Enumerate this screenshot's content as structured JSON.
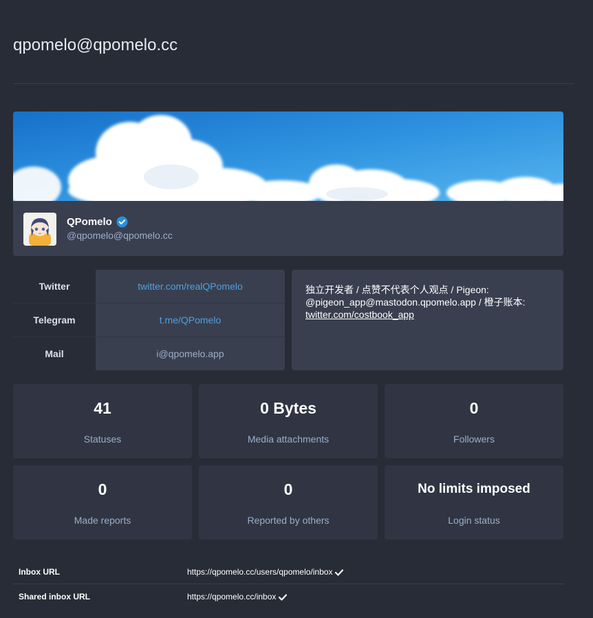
{
  "page": {
    "title": "qpomelo@qpomelo.cc"
  },
  "account": {
    "display_name": "QPomelo",
    "username": "@qpomelo@qpomelo.cc",
    "avatar_icon": "anime-avatar",
    "verified_icon": "verified-badge-icon",
    "accent_color": "#2b90d9"
  },
  "fields": [
    {
      "name": "Twitter",
      "value": "twitter.com/realQPomelo",
      "is_link": true
    },
    {
      "name": "Telegram",
      "value": "t.me/QPomelo",
      "is_link": true
    },
    {
      "name": "Mail",
      "value": "i@qpomelo.app",
      "is_link": false
    }
  ],
  "bio": {
    "line1": "独立开发者 / 点赞不代表个人观点 / Pigeon:",
    "line2": "@pigeon_app@mastodon.qpomelo.app / 橙子账本:",
    "link": "twitter.com/costbook_app"
  },
  "stats": [
    {
      "value": "41",
      "label": "Statuses"
    },
    {
      "value": "0 Bytes",
      "label": "Media attachments"
    },
    {
      "value": "0",
      "label": "Followers"
    },
    {
      "value": "0",
      "label": "Made reports"
    },
    {
      "value": "0",
      "label": "Reported by others"
    },
    {
      "value": "No limits imposed",
      "label": "Login status"
    }
  ],
  "inbox": [
    {
      "label": "Inbox URL",
      "value": "https://qpomelo.cc/users/qpomelo/inbox",
      "icon": "check-icon"
    },
    {
      "label": "Shared inbox URL",
      "value": "https://qpomelo.cc/inbox",
      "icon": "check-icon"
    }
  ]
}
